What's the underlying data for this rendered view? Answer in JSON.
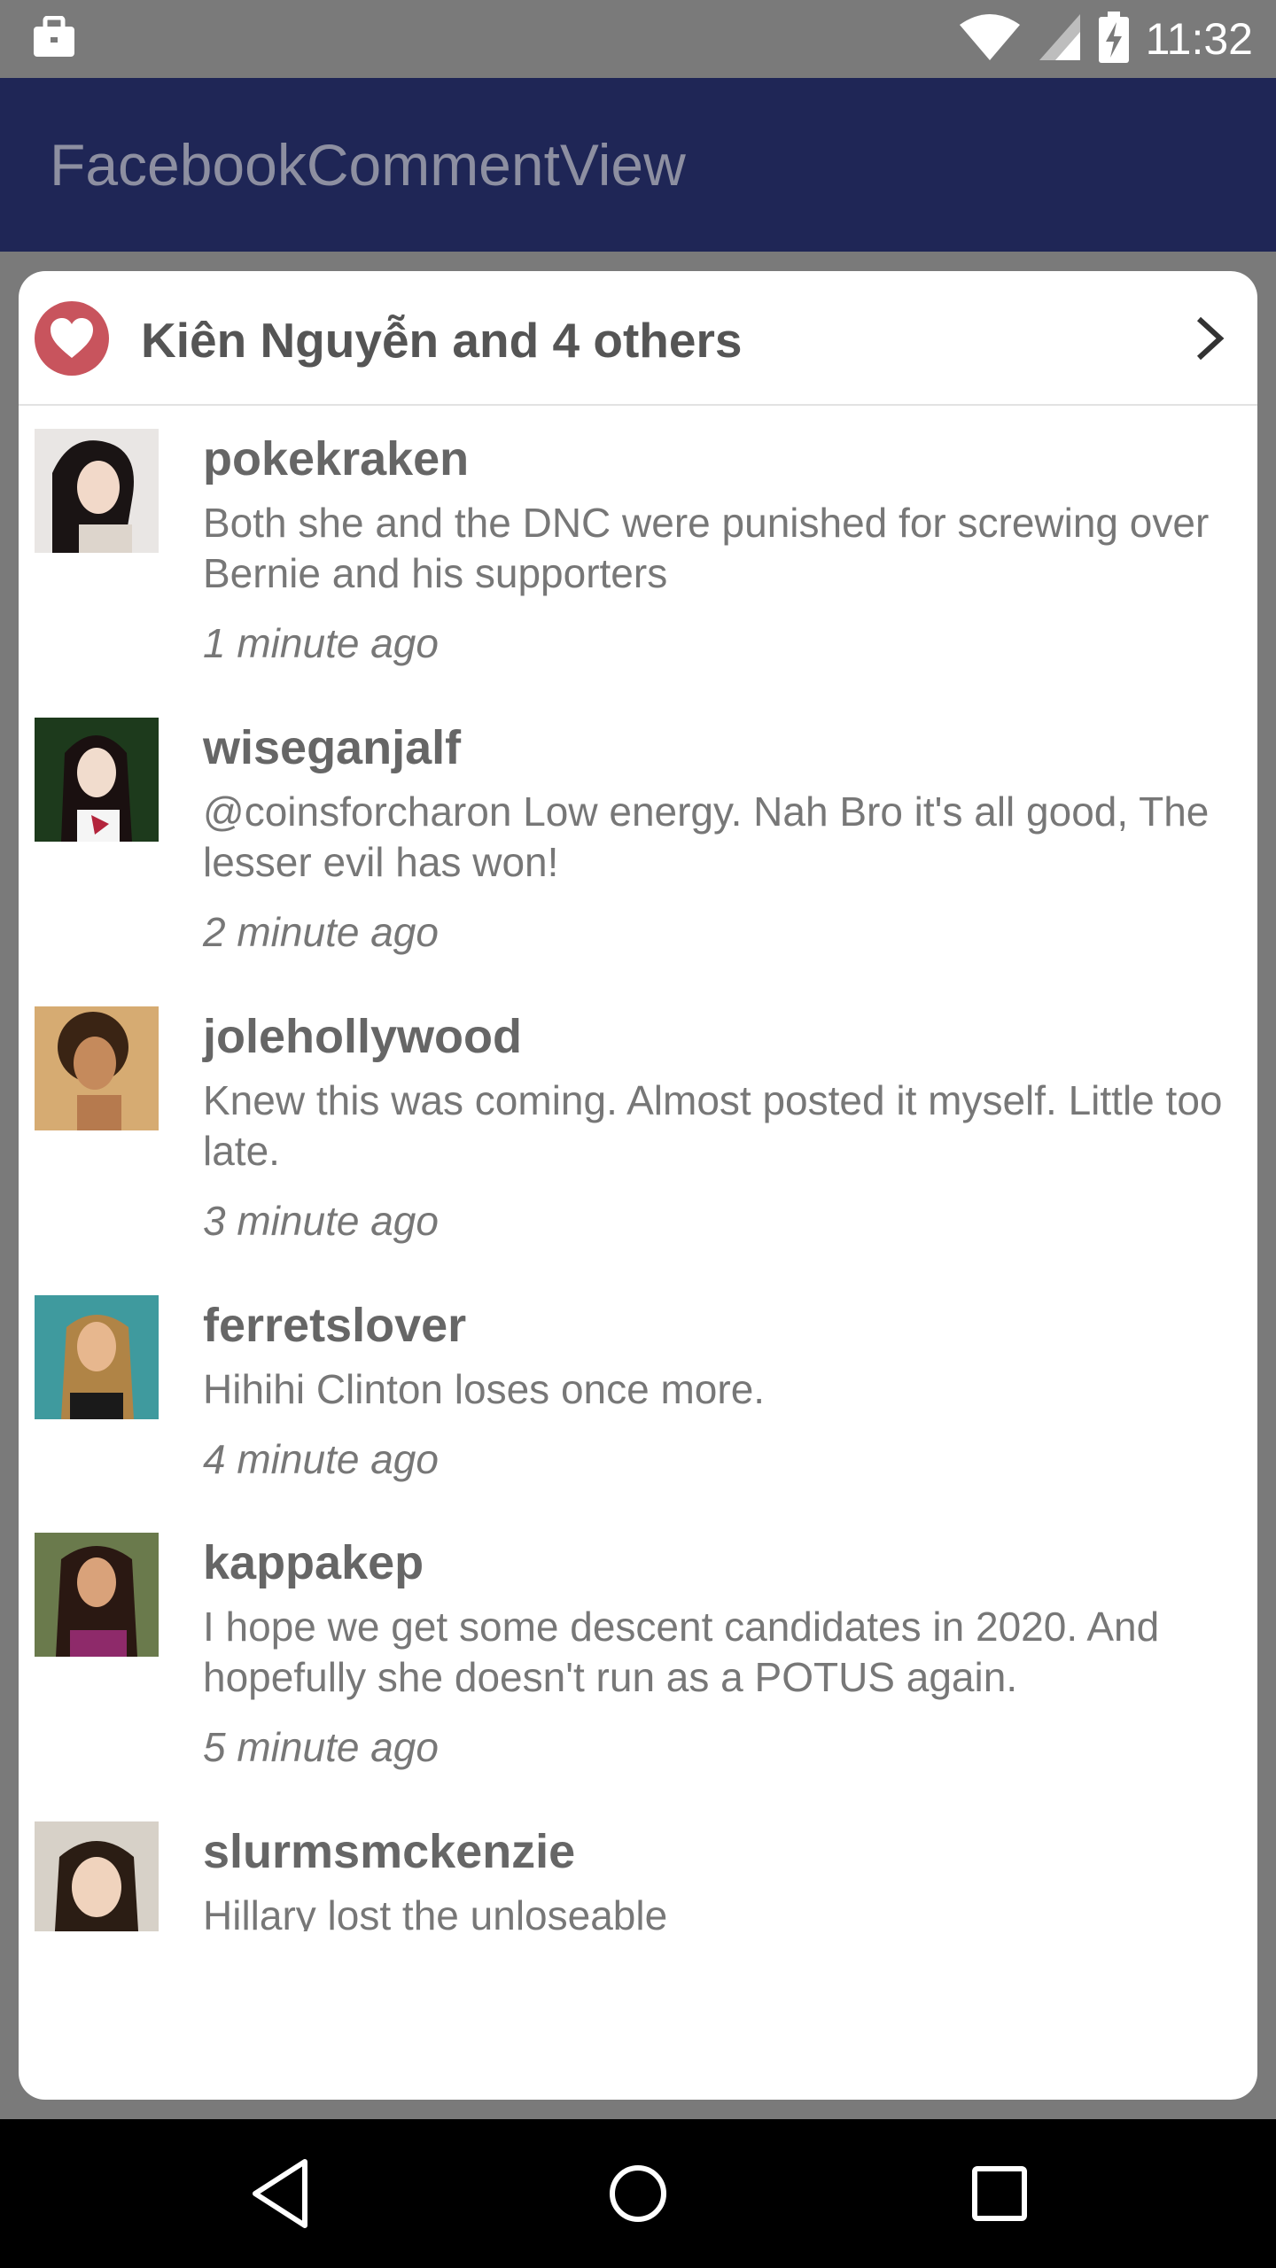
{
  "status_bar": {
    "time": "11:32",
    "icons": [
      "briefcase-icon",
      "wifi-icon",
      "signal-icon",
      "battery-charging-icon"
    ]
  },
  "app_bar": {
    "title": "FacebookCommentView"
  },
  "likes": {
    "text": "Kiên Nguyễn and 4 others",
    "icon": "heart-icon",
    "chevron": "chevron-right-icon"
  },
  "comments": [
    {
      "username": "pokekraken",
      "text": "Both she and the DNC were punished for screwing over Bernie and his supporters",
      "time": "1 minute ago"
    },
    {
      "username": "wiseganjalf",
      "text": "@coinsforcharon Low energy. Nah Bro it's all good, The lesser evil has won!",
      "time": "2 minute ago"
    },
    {
      "username": "jolehollywood",
      "text": "Knew this was coming. Almost posted it myself. Little too late.",
      "time": "3 minute ago"
    },
    {
      "username": "ferretslover",
      "text": "Hihihi Clinton loses once more.",
      "time": "4 minute ago"
    },
    {
      "username": "kappakep",
      "text": "I hope we get some descent candidates in 2020. And hopefully she doesn't run as a POTUS again.",
      "time": "5 minute ago"
    },
    {
      "username": "slurmsmckenzie",
      "text": "Hillary lost the unloseable",
      "time": ""
    }
  ],
  "nav": {
    "back": "back-triangle-icon",
    "home": "home-circle-icon",
    "recents": "recents-square-icon"
  },
  "colors": {
    "app_bar": "#1f2656",
    "heart": "#c8545d",
    "status_bar": "#7a7a7a"
  }
}
